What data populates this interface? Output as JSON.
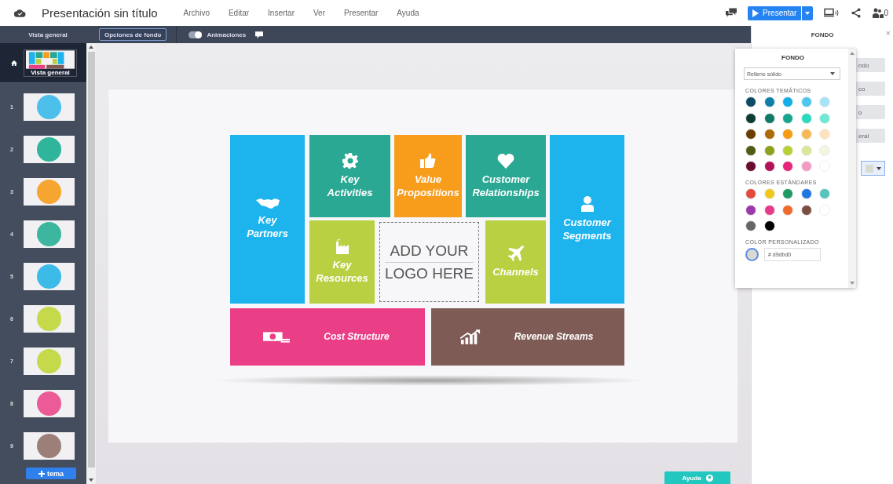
{
  "header": {
    "title": "Presentación sin título",
    "menu": [
      "Archivo",
      "Editar",
      "Insertar",
      "Ver",
      "Presentar",
      "Ayuda"
    ],
    "present_button": "Presentar",
    "collaborators": "0"
  },
  "toolbar": {
    "tabs": [
      {
        "label": "Vista general",
        "selected": false
      },
      {
        "label": "Opciones de fondo",
        "selected": true
      }
    ],
    "animations": {
      "label": "Animaciones",
      "on": true
    }
  },
  "sidebar": {
    "overview": {
      "label": "Vista general",
      "selected": true
    },
    "slides": [
      {
        "number": "1",
        "color": "#4cc0ea"
      },
      {
        "number": "2",
        "color": "#2fb59c"
      },
      {
        "number": "3",
        "color": "#f7a531"
      },
      {
        "number": "4",
        "color": "#3cb69f"
      },
      {
        "number": "5",
        "color": "#3cbbe9"
      },
      {
        "number": "6",
        "color": "#c5d94a"
      },
      {
        "number": "7",
        "color": "#c5d94a"
      },
      {
        "number": "8",
        "color": "#ec5a97"
      },
      {
        "number": "9",
        "color": "#9c7f78"
      }
    ],
    "add_button": "tema"
  },
  "slide": {
    "blocks": [
      {
        "title": "Key Partners",
        "color": "#1db4ee"
      },
      {
        "title": "Key Activities",
        "color": "#2aa893"
      },
      {
        "title": "Value Propositions",
        "color": "#f89c1c"
      },
      {
        "title": "Customer Relationships",
        "color": "#2aa893"
      },
      {
        "title": "Customer Segments",
        "color": "#1db4ee"
      },
      {
        "title": "Key Resources",
        "color": "#b9d043"
      },
      {
        "title": "Channels",
        "color": "#b9d043"
      },
      {
        "title": "Cost Structure",
        "color": "#ea3f86"
      },
      {
        "title": "Revenue Streams",
        "color": "#7e5c55"
      }
    ],
    "logo_placeholder": [
      "ADD YOUR",
      "LOGO HERE"
    ]
  },
  "panel": {
    "title": "FONDO",
    "close": "×",
    "options": [
      "ndo",
      "co",
      "o",
      "eral"
    ]
  },
  "color_picker": {
    "title": "FONDO",
    "fill_type": "Relleno sólido",
    "theme_label": "COLORES TEMÁTICOS",
    "theme_colors": [
      {
        "color": "#0d4a63"
      },
      {
        "color": "#0f7fa8"
      },
      {
        "color": "#14aee6"
      },
      {
        "color": "#4ec7f0"
      },
      {
        "color": "#a6e3f7"
      },
      {
        "color": "#0b3d33"
      },
      {
        "color": "#10796a"
      },
      {
        "color": "#16a68f"
      },
      {
        "color": "#2bd9c0"
      },
      {
        "color": "#6fe8d5"
      },
      {
        "color": "#6b3d05"
      },
      {
        "color": "#ad6a08"
      },
      {
        "color": "#f59b12"
      },
      {
        "color": "#f6b955"
      },
      {
        "color": "#fde2bd"
      },
      {
        "color": "#4f5c12"
      },
      {
        "color": "#8aa21f"
      },
      {
        "color": "#b8cf35"
      },
      {
        "color": "#d8e79a"
      },
      {
        "color": "#f1f6e1"
      },
      {
        "color": "#6a0c30"
      },
      {
        "color": "#b5105a"
      },
      {
        "color": "#e8247a"
      },
      {
        "color": "#f29cc4"
      },
      {
        "color": "#ffffff"
      }
    ],
    "standard_label": "COLORES ESTÁNDARES",
    "standard_colors": [
      {
        "color": "#e24a3b"
      },
      {
        "color": "#f2c71c"
      },
      {
        "color": "#1e9a62"
      },
      {
        "color": "#1f78e0"
      },
      {
        "color": "#55c4bd"
      },
      {
        "color": "#9a3aab"
      },
      {
        "color": "#e83a8a"
      },
      {
        "color": "#f26a2a"
      },
      {
        "color": "#7b4e44"
      },
      {
        "color": "#ffffff"
      },
      {
        "color": "#666666"
      },
      {
        "color": "#000000"
      }
    ],
    "custom_label": "COLOR PERSONALIZADO",
    "custom_hex": "# d9dbd0"
  },
  "help_button": "Ayuda"
}
